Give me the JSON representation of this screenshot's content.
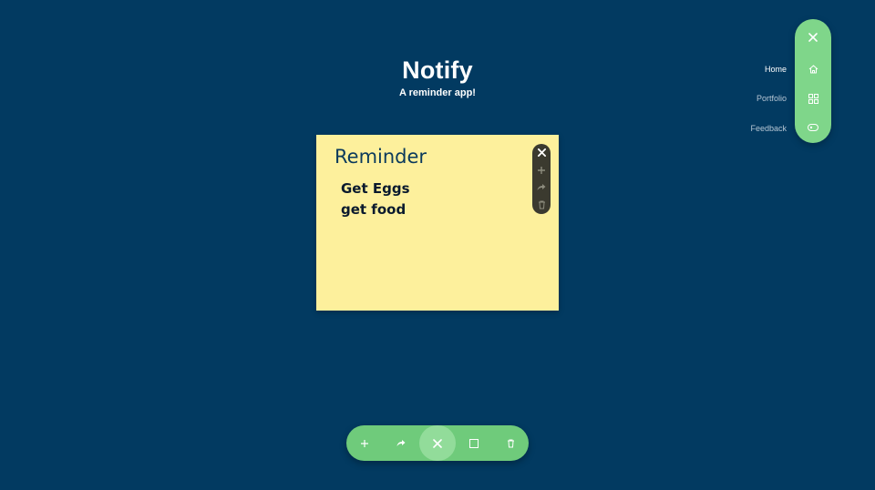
{
  "app": {
    "title": "Notify",
    "subtitle": "A reminder app!"
  },
  "note": {
    "title": "Reminder",
    "lines": [
      "Get Eggs",
      "get food"
    ],
    "toolbar": {
      "icons": [
        "close-icon",
        "plus-icon",
        "share-icon",
        "trash-icon"
      ]
    }
  },
  "side_nav": {
    "items": [
      {
        "label": "Home",
        "icon": "home-icon",
        "active": true
      },
      {
        "label": "Portfolio",
        "icon": "grid-icon",
        "active": false
      },
      {
        "label": "Feedback",
        "icon": "feedback-icon",
        "active": false
      }
    ],
    "close_icon": "close-icon"
  },
  "bottom_toolbar": {
    "icons": [
      "plus-icon",
      "share-icon",
      "close-icon",
      "square-icon",
      "trash-icon"
    ]
  },
  "colors": {
    "background": "#023a61",
    "note": "#fdf09c",
    "accent_green": "#7fd68a",
    "note_toolbar": "#3b3a2f"
  }
}
